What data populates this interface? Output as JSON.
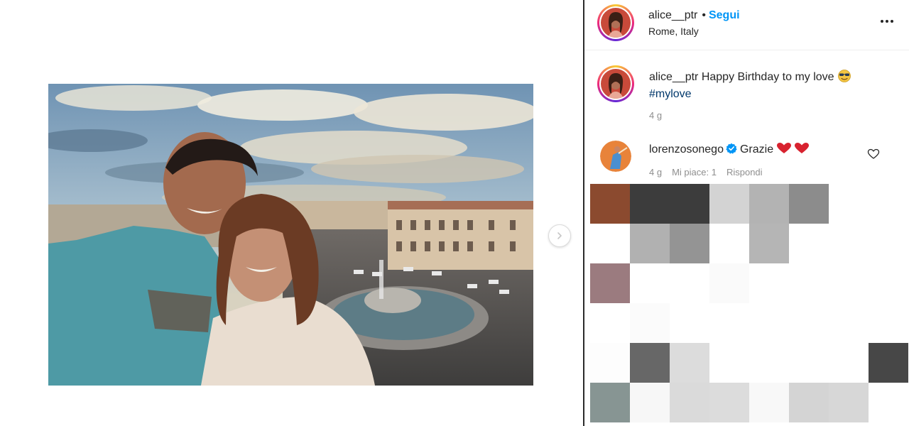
{
  "post": {
    "username": "alice__ptr",
    "follow_label": "Segui",
    "location": "Rome, Italy",
    "more_label": "•••"
  },
  "caption": {
    "username": "alice__ptr",
    "text": "Happy Birthday to my love",
    "hashtag": "#mylove",
    "time": "4 g",
    "emoji": "smiling-face-with-sunglasses-emoji"
  },
  "comment": {
    "username": "lorenzosonego",
    "text": "Grazie",
    "time": "4 g",
    "likes_label": "Mi piace: 1",
    "reply_label": "Rispondi",
    "verified": true
  },
  "colors": {
    "follow": "#0095f6",
    "hashtag": "#00376b",
    "verified": "#0095f6",
    "heart": "#ed4956",
    "muted_text": "#8e8e8e"
  },
  "mosaic_colors": [
    "#8b4a2f",
    "#3c3c3c",
    "#3c3c3c",
    "#d3d3d3",
    "#b3b3b3",
    "#8c8c8c",
    "#ffffff",
    "#ffffff",
    "#ffffff",
    "#b1b1b1",
    "#949494",
    "#ffffff",
    "#b5b5b5",
    "#ffffff",
    "#ffffff",
    "#ffffff",
    "#9b7b7f",
    "#ffffff",
    "#ffffff",
    "#fafafa",
    "#ffffff",
    "#ffffff",
    "#ffffff",
    "#ffffff",
    "#ffffff",
    "#fbfbfb",
    "#ffffff",
    "#ffffff",
    "#ffffff",
    "#ffffff",
    "#ffffff",
    "#ffffff",
    "#fdfdfd",
    "#676767",
    "#dcdcdc",
    "#ffffff",
    "#ffffff",
    "#ffffff",
    "#ffffff",
    "#474747",
    "#879593",
    "#f7f7f7",
    "#dadada",
    "#dcdcdc",
    "#f8f8f8",
    "#d4d4d4",
    "#d7d7d7",
    "#ffffff"
  ]
}
